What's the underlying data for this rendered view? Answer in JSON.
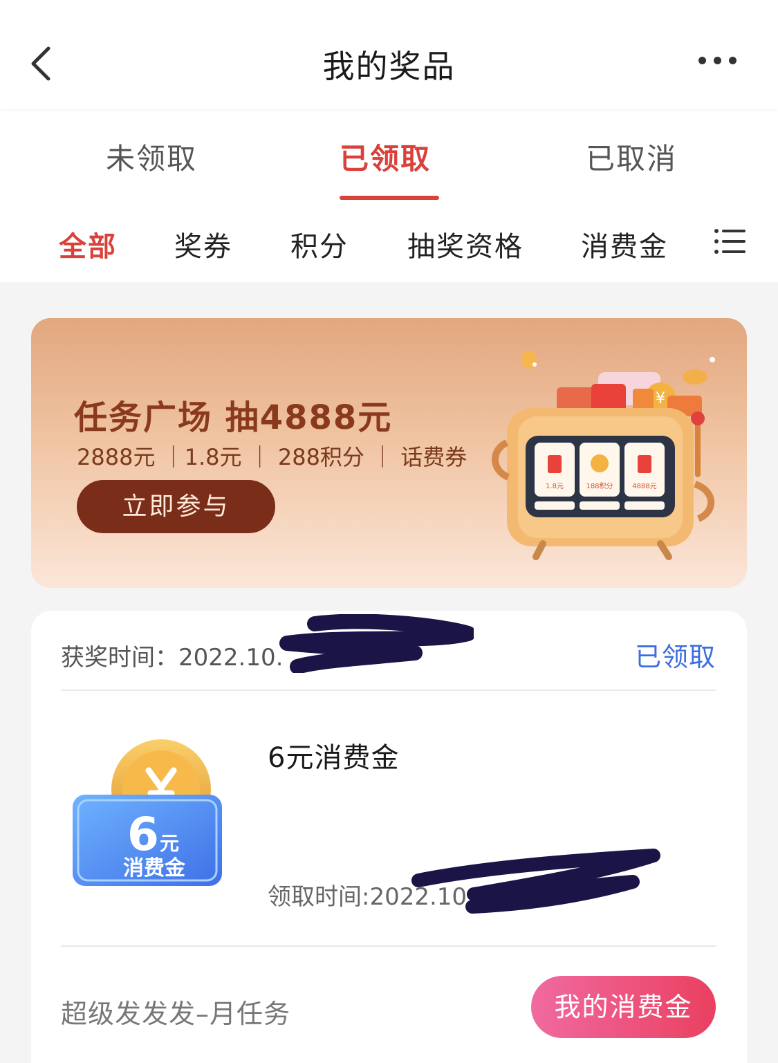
{
  "header": {
    "title": "我的奖品"
  },
  "tabs": [
    {
      "label": "未领取"
    },
    {
      "label": "已领取"
    },
    {
      "label": "已取消"
    }
  ],
  "filters": [
    {
      "label": "全部"
    },
    {
      "label": "奖券"
    },
    {
      "label": "积分"
    },
    {
      "label": "抽奖资格"
    },
    {
      "label": "消费金"
    }
  ],
  "banner": {
    "title": "任务广场 抽4888元",
    "subtitle": "2888元 ｜1.8元 ｜ 288积分 ｜ 话费券",
    "button": "立即参与",
    "slots": [
      "1.8元",
      "188积分",
      "4888元"
    ]
  },
  "card": {
    "award_time": "获奖时间：2022.10.",
    "status": "已领取",
    "prize_name": "6元消费金",
    "coupon_amount": "6",
    "coupon_unit": "元",
    "coupon_type": "消费金",
    "claim_time": "领取时间:2022.10.",
    "task_name": "超级发发发–月任务",
    "action_button": "我的消费金"
  },
  "colors": {
    "accent_red": "#d9413a",
    "status_blue": "#3d6ee0",
    "banner_button": "#7a2e1a"
  }
}
